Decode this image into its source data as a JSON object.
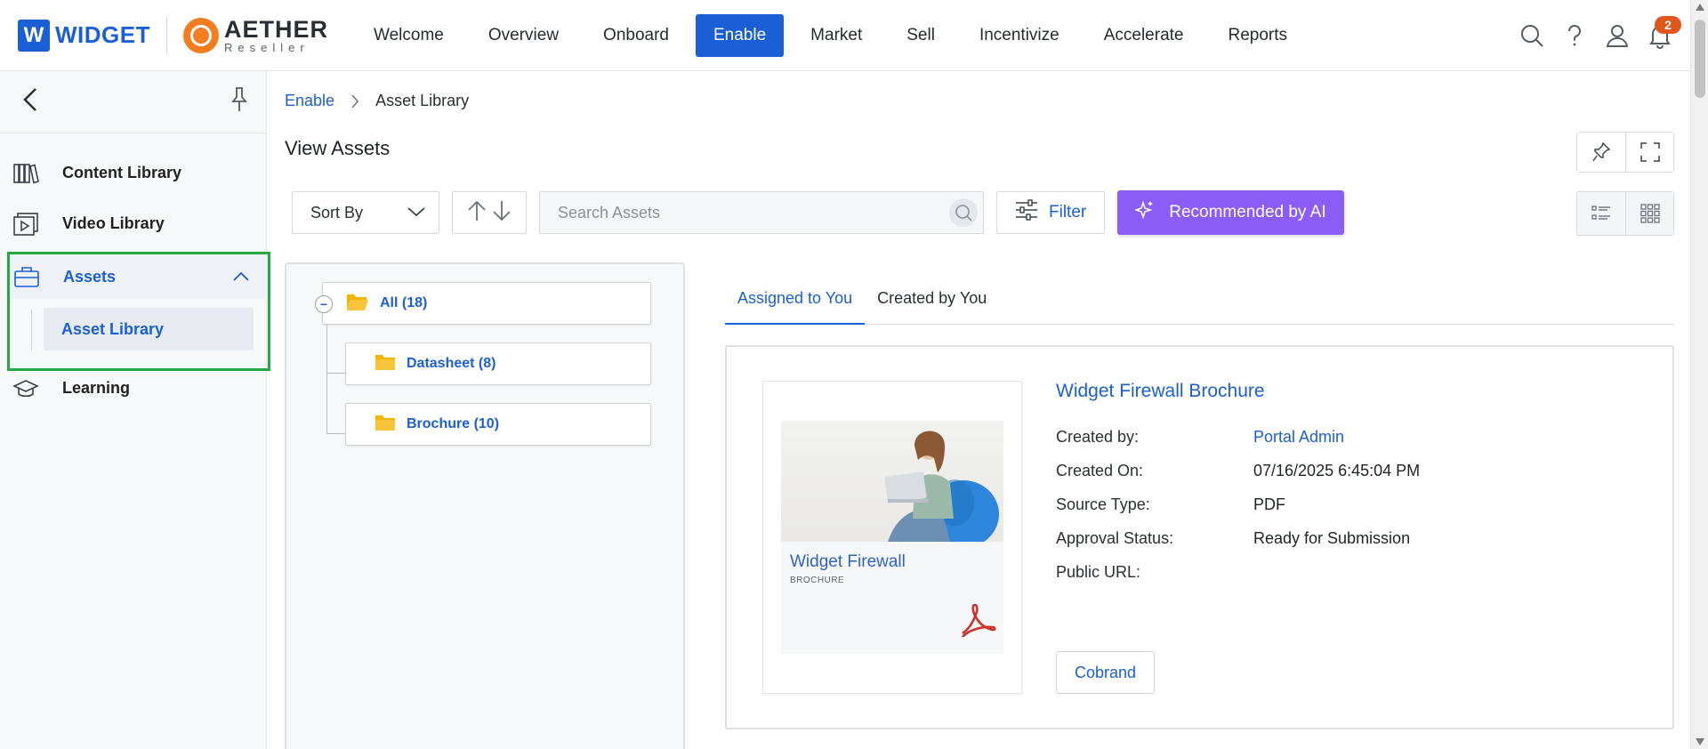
{
  "brand": {
    "widget_letter": "W",
    "widget_name": "WIDGET",
    "aether_name": "AETHER",
    "aether_sub": "Reseller",
    "accent": "#1a5fd6",
    "aether_color": "#f47d20"
  },
  "nav": {
    "items": [
      {
        "label": "Welcome"
      },
      {
        "label": "Overview"
      },
      {
        "label": "Onboard"
      },
      {
        "label": "Enable",
        "active": true
      },
      {
        "label": "Market"
      },
      {
        "label": "Sell"
      },
      {
        "label": "Incentivize"
      },
      {
        "label": "Accelerate"
      },
      {
        "label": "Reports"
      }
    ]
  },
  "top_icons": {
    "icons": [
      "search-icon",
      "help-icon",
      "user-icon",
      "bell-icon"
    ],
    "notification_count": "2"
  },
  "sidebar": {
    "items": [
      {
        "label": "Content Library",
        "icon": "books-icon"
      },
      {
        "label": "Video Library",
        "icon": "video-icon"
      },
      {
        "label": "Assets",
        "icon": "briefcase-icon",
        "expanded": true
      },
      {
        "label": "Asset Library",
        "sub": true,
        "active": true
      },
      {
        "label": "Learning",
        "icon": "graduation-cap-icon"
      }
    ],
    "highlight_color": "#28a745"
  },
  "breadcrumb": {
    "parent": "Enable",
    "current": "Asset Library"
  },
  "page": {
    "title": "View Assets"
  },
  "toolbar": {
    "sort_label": "Sort By",
    "search_placeholder": "Search Assets",
    "filter_label": "Filter",
    "ai_label": "Recommended by AI",
    "ai_color": "#8b5cf6"
  },
  "tree": {
    "root": {
      "label": "All (18)"
    },
    "children": [
      {
        "label": "Datasheet (8)"
      },
      {
        "label": "Brochure (10)"
      }
    ],
    "folder_color": "#f5b400"
  },
  "tabs": {
    "items": [
      {
        "label": "Assigned to You",
        "active": true
      },
      {
        "label": "Created by You"
      }
    ]
  },
  "asset": {
    "title": "Widget Firewall Brochure",
    "thumb_title": "Widget Firewall",
    "thumb_sub": "BROCHURE",
    "fields": [
      {
        "label": "Created by:",
        "value": "Portal Admin",
        "link": true
      },
      {
        "label": "Created On:",
        "value": "07/16/2025 6:45:04 PM"
      },
      {
        "label": "Source Type:",
        "value": "PDF"
      },
      {
        "label": "Approval Status:",
        "value": "Ready for Submission"
      },
      {
        "label": "Public URL:",
        "value": ""
      }
    ],
    "cobrand_label": "Cobrand"
  }
}
